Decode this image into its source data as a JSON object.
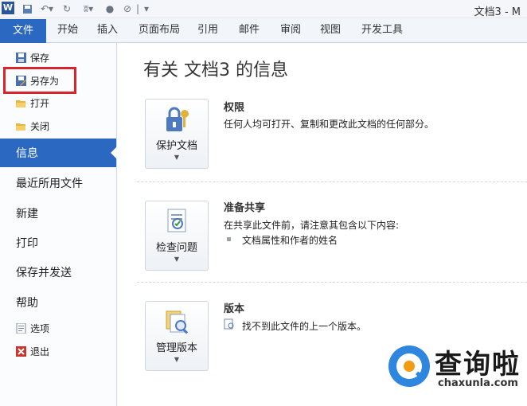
{
  "app": {
    "title": "文档3 - M",
    "logo": "W"
  },
  "quick_access": [
    "save-icon",
    "undo-icon",
    "redo-icon",
    "format-painter-icon",
    "print-icon",
    "separator",
    "customize-icon"
  ],
  "ribbon_tabs": [
    "文件",
    "开始",
    "插入",
    "页面布局",
    "引用",
    "邮件",
    "审阅",
    "视图",
    "开发工具"
  ],
  "sidebar": {
    "save": "保存",
    "save_as": "另存为",
    "open": "打开",
    "close": "关闭",
    "info": "信息",
    "recent": "最近所用文件",
    "new": "新建",
    "print": "打印",
    "save_send": "保存并发送",
    "help": "帮助",
    "options": "选项",
    "exit": "退出"
  },
  "main": {
    "heading": "有关 文档3 的信息",
    "sections": [
      {
        "button": "保护文档",
        "title": "权限",
        "text": "任何人均可打开、复制和更改此文档的任何部分。"
      },
      {
        "button": "检查问题",
        "title": "准备共享",
        "text": "在共享此文件前，请注意其包含以下内容:",
        "bullet": "文档属性和作者的姓名"
      },
      {
        "button": "管理版本",
        "title": "版本",
        "text": "找不到此文件的上一个版本。"
      }
    ]
  },
  "watermark": {
    "title": "查询啦",
    "sub": "chaxunla.com"
  },
  "colors": {
    "file_tab": "#2b68c1",
    "highlight": "#d9242b",
    "watermark_blue": "#2e86de",
    "watermark_orange": "#f39c12"
  }
}
